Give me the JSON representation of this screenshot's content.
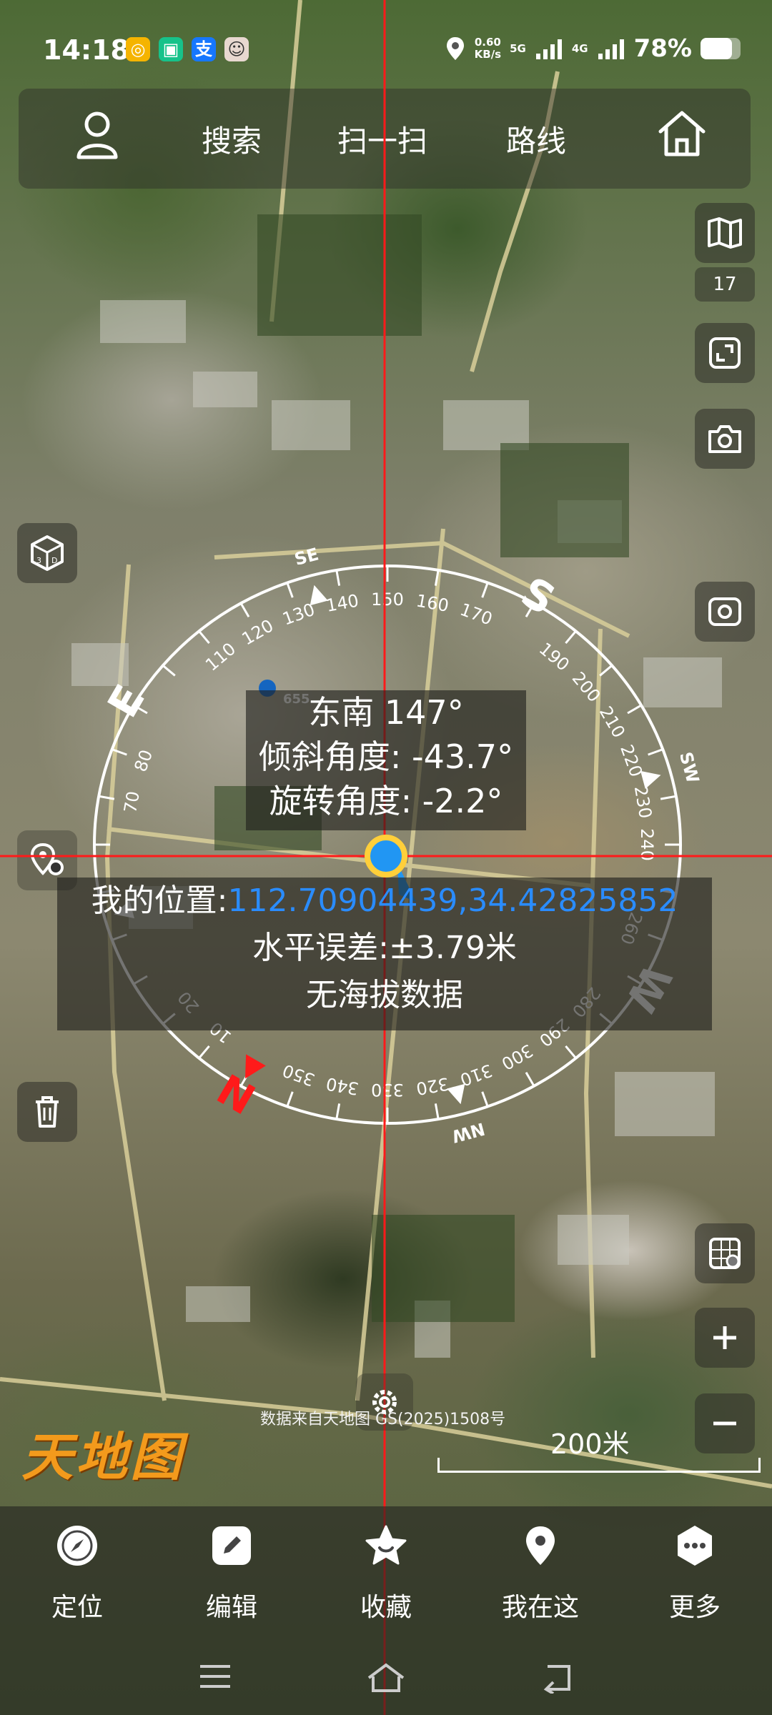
{
  "status_bar": {
    "time": "14:18",
    "app_icons": [
      "yellow-app-icon",
      "green-app-icon",
      "alipay-icon",
      "avatar-icon"
    ],
    "alipay_glyph": "支",
    "net_speed_value": "0.60",
    "net_speed_unit": "KB/s",
    "net_type_1": "5G",
    "net_type_2": "4G",
    "battery": "78%"
  },
  "top_bar": {
    "items": [
      {
        "label": "搜索"
      },
      {
        "label": "扫一扫"
      },
      {
        "label": "路线"
      }
    ]
  },
  "side_controls": {
    "zoom_level": "17"
  },
  "compass": {
    "degree_labels": [
      "110",
      "120",
      "130",
      "140",
      "150",
      "160",
      "170",
      "190",
      "200",
      "210",
      "220",
      "230",
      "240",
      "260",
      "280",
      "290",
      "300",
      "310",
      "320",
      "330",
      "340",
      "350",
      "10",
      "20",
      "70",
      "80"
    ],
    "cardinals": [
      "SE",
      "S",
      "SW",
      "W",
      "NW",
      "N",
      "E"
    ],
    "marker_label": "655"
  },
  "orientation_info": {
    "heading": "东南 147°",
    "tilt": "倾斜角度: -43.7°",
    "rotation": "旋转角度: -2.2°"
  },
  "location_info": {
    "label": "我的位置:",
    "coordinates": "112.70904439,34.42825852",
    "horizontal_error": "水平误差:±3.79米",
    "altitude": "无海拔数据"
  },
  "map_footer": {
    "attribution": "数据来自天地图 GS(2025)1508号",
    "scale": "200米",
    "logo": "天地图"
  },
  "bottom_bar": {
    "items": [
      {
        "label": "定位",
        "icon": "compass-icon"
      },
      {
        "label": "编辑",
        "icon": "edit-icon"
      },
      {
        "label": "收藏",
        "icon": "star-icon"
      },
      {
        "label": "我在这",
        "icon": "location-pin-icon"
      },
      {
        "label": "更多",
        "icon": "more-icon"
      }
    ]
  },
  "colors": {
    "crosshair": "#ff1a1a",
    "coordinate_text": "#2a8cff",
    "north_marker": "#ff1a1a",
    "location_dot": "#2196f3"
  }
}
